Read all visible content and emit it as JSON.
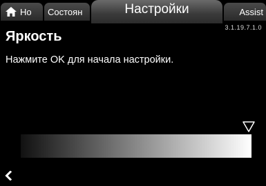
{
  "header": {
    "tabs": [
      {
        "id": "home",
        "label": "Но",
        "icon": "home-icon"
      },
      {
        "id": "status",
        "label": "Состоян"
      },
      {
        "id": "settings",
        "label": "Настройки",
        "active": true
      },
      {
        "id": "assist",
        "label": "Assist"
      }
    ],
    "version": "3.1.19.7.1.0"
  },
  "main": {
    "title": "Яркость",
    "instruction": "Нажмите OK для начала настройки."
  },
  "brightness": {
    "level": 1.0,
    "gradient_start": "#111111",
    "gradient_end": "#ffffff"
  },
  "footer": {
    "back_icon": "chevron-left-icon"
  },
  "colors": {
    "background": "#000000",
    "text": "#ffffff"
  }
}
